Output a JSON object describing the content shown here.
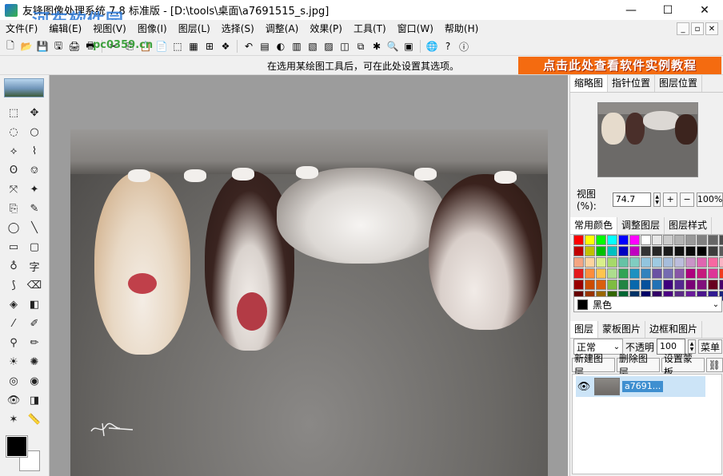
{
  "window": {
    "title": "友锋图像处理系统 7.8 标准版 - [D:\\tools\\桌面\\a7691515_s.jpg]",
    "minimize": "—",
    "maximize": "☐",
    "close": "✕"
  },
  "overlay": {
    "watermark": "河东软件园",
    "watermark_url": "pc0359.cn"
  },
  "menu": {
    "items": [
      "文件(F)",
      "编辑(E)",
      "视图(V)",
      "图像(I)",
      "图层(L)",
      "选择(S)",
      "调整(A)",
      "效果(P)",
      "工具(T)",
      "窗口(W)",
      "帮助(H)"
    ],
    "mdi_min": "_",
    "mdi_restore": "▫",
    "mdi_close": "✕"
  },
  "toolbar": {
    "icons": [
      "new-icon",
      "open-icon",
      "save-icon",
      "save-as-icon",
      "scan-icon",
      "print-icon",
      "cut-icon",
      "copy-icon",
      "paste-icon",
      "paste-new-icon",
      "crop-icon",
      "select-all-icon",
      "deselect-icon",
      "effects-icon",
      "undo-icon",
      "levels-icon",
      "hue-icon",
      "channels-icon",
      "color-balance-icon",
      "gradient-icon",
      "mask-icon",
      "layer-icon",
      "filter-icon",
      "browse-icon",
      "batch-icon",
      "web-icon",
      "help-icon",
      "info-icon"
    ]
  },
  "options": {
    "hint": "在选用某绘图工具后，可在此处设置其选项。",
    "banner": "点击此处查看软件实例教程"
  },
  "tools": {
    "items": [
      {
        "name": "rect-select-tool",
        "glyph": "⬚"
      },
      {
        "name": "move-tool",
        "glyph": "✥"
      },
      {
        "name": "ellipse-select-tool",
        "glyph": "◌"
      },
      {
        "name": "circle-select-tool",
        "glyph": "○"
      },
      {
        "name": "lasso-tool",
        "glyph": "⟡"
      },
      {
        "name": "polygon-lasso-tool",
        "glyph": "⌇"
      },
      {
        "name": "free-select-tool",
        "glyph": "ʘ"
      },
      {
        "name": "magnetic-select-tool",
        "glyph": "⎊"
      },
      {
        "name": "transform-tool",
        "glyph": "⤧"
      },
      {
        "name": "magic-wand-tool",
        "glyph": "✦"
      },
      {
        "name": "stamp-tool",
        "glyph": "⎘"
      },
      {
        "name": "pencil-tool",
        "glyph": "✎"
      },
      {
        "name": "ellipse-shape-tool",
        "glyph": "◯"
      },
      {
        "name": "line-tool",
        "glyph": "╲"
      },
      {
        "name": "rect-shape-tool",
        "glyph": "▭"
      },
      {
        "name": "rounded-rect-tool",
        "glyph": "▢"
      },
      {
        "name": "freeform-shape-tool",
        "glyph": "♁"
      },
      {
        "name": "text-tool",
        "glyph": "字"
      },
      {
        "name": "path-tool",
        "glyph": "⟆"
      },
      {
        "name": "eraser-tool",
        "glyph": "⌫"
      },
      {
        "name": "fill-tool",
        "glyph": "◈"
      },
      {
        "name": "gradient-tool",
        "glyph": "◧"
      },
      {
        "name": "eyedropper-tool",
        "glyph": "⁄"
      },
      {
        "name": "brush-tool",
        "glyph": "✐"
      },
      {
        "name": "zoom-tool",
        "glyph": "⚲"
      },
      {
        "name": "airbrush-tool",
        "glyph": "✏"
      },
      {
        "name": "dodge-tool",
        "glyph": "☀"
      },
      {
        "name": "burn-tool",
        "glyph": "✺"
      },
      {
        "name": "sponge-tool",
        "glyph": "◎"
      },
      {
        "name": "red-eye-tool",
        "glyph": "◉"
      },
      {
        "name": "view-tool",
        "glyph": "👁"
      },
      {
        "name": "frame-tool",
        "glyph": "◨"
      },
      {
        "name": "spray-tool",
        "glyph": "✶"
      },
      {
        "name": "ruler-tool",
        "glyph": "📏"
      }
    ]
  },
  "panel": {
    "tabs_top": [
      "缩略图",
      "指针位置",
      "图层位置"
    ],
    "zoom_label": "视图(%):",
    "zoom_value": "74.7",
    "zoom_in": "+",
    "zoom_out": "−",
    "zoom_100": "100%",
    "tabs_color": [
      "常用颜色",
      "调整图层",
      "图层样式"
    ],
    "palette": [
      "#ff0000",
      "#ffff00",
      "#00ff00",
      "#00ffff",
      "#0000ff",
      "#ff00ff",
      "#ffffff",
      "#e6e6e6",
      "#cccccc",
      "#b3b3b3",
      "#999999",
      "#808080",
      "#666666",
      "#4d4d4d",
      "#c00000",
      "#c0c000",
      "#00c000",
      "#00c0c0",
      "#0000c0",
      "#c000c0",
      "#333333",
      "#262626",
      "#1a1a1a",
      "#111111",
      "#0a0a0a",
      "#000000",
      "#3c3c3c",
      "#5a5a5a",
      "#f4a582",
      "#fdd49e",
      "#d9ef8b",
      "#a6d96a",
      "#66c2a5",
      "#80cdc1",
      "#92c5de",
      "#9ecae1",
      "#a6bddb",
      "#bcbddc",
      "#c994c7",
      "#df65b0",
      "#f768a1",
      "#fbb4c4",
      "#e31a1c",
      "#fd8d3c",
      "#fec44f",
      "#addd8e",
      "#31a354",
      "#1d91c0",
      "#3182bd",
      "#6a51a3",
      "#756bb1",
      "#8856a7",
      "#ae017e",
      "#c51b7d",
      "#dd3497",
      "#f03b20",
      "#990000",
      "#cc4c02",
      "#d95f0e",
      "#7fbc41",
      "#238443",
      "#0868ac",
      "#08519c",
      "#2171b5",
      "#3f007d",
      "#54278f",
      "#7a0177",
      "#810f7c",
      "#67001f",
      "#49006a",
      "#660000",
      "#993300",
      "#996600",
      "#336600",
      "#006633",
      "#003366",
      "#000066",
      "#330066",
      "#4b0082",
      "#5b2a86",
      "#6a1b9a",
      "#4a148c",
      "#311b92",
      "#1a237e"
    ],
    "color_selected": "黑色",
    "tabs_layers": [
      "图层",
      "蒙板图片",
      "边框和图片"
    ],
    "blend_mode": "正常",
    "opacity_label": "不透明",
    "opacity_value": "100",
    "mask_button": "菜单",
    "layer_buttons": [
      "新建图层",
      "删除图层",
      "设置蒙板"
    ],
    "layer_name": "a7691..."
  }
}
